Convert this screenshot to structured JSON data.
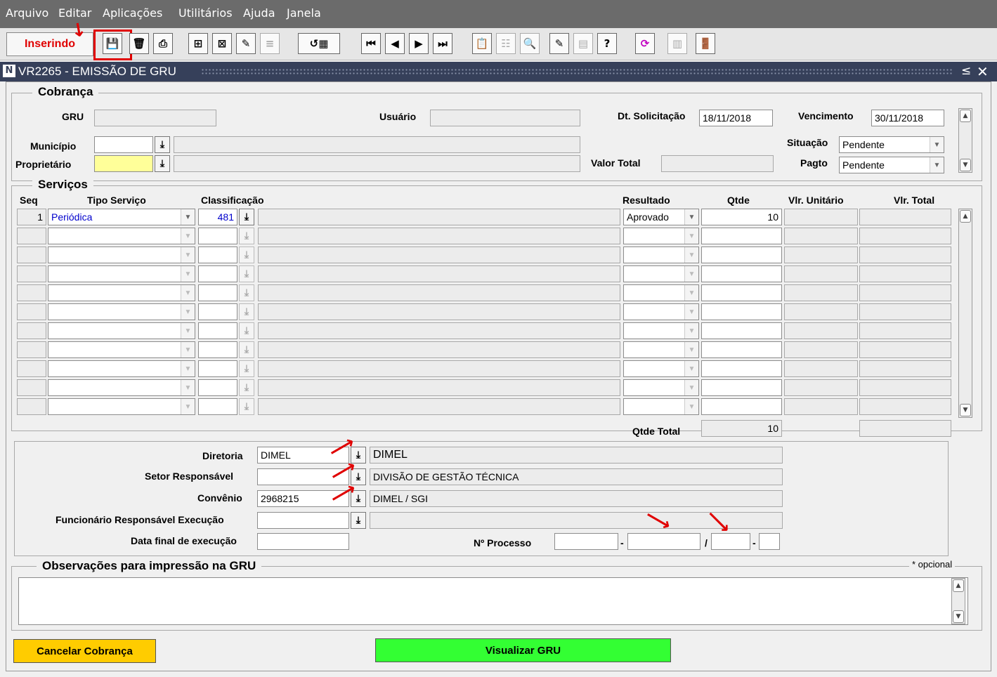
{
  "menu": [
    "Arquivo",
    "Editar",
    "Aplicações",
    "Utilitários",
    "Ajuda",
    "Janela"
  ],
  "toolbar": {
    "mode_label": "Inserindo"
  },
  "window": {
    "title": "VR2265 - EMISSÃO DE GRU"
  },
  "cobranca": {
    "title": "Cobrança",
    "gru_label": "GRU",
    "gru_value": "",
    "usuario_label": "Usuário",
    "usuario_value": "",
    "dt_solicitacao_label": "Dt. Solicitação",
    "dt_solicitacao_value": "18/11/2018",
    "vencimento_label": "Vencimento",
    "vencimento_value": "30/11/2018",
    "municipio_label": "Município",
    "municipio_value": "",
    "proprietario_label": "Proprietário",
    "proprietario_value": "",
    "situacao_label": "Situação",
    "situacao_value": "Pendente",
    "valor_total_label": "Valor Total",
    "valor_total_value": "",
    "pagto_label": "Pagto",
    "pagto_value": "Pendente"
  },
  "servicos": {
    "title": "Serviços",
    "columns": {
      "seq": "Seq",
      "tipo": "Tipo Serviço",
      "classificacao": "Classificação",
      "resultado": "Resultado",
      "qtde": "Qtde",
      "vlr_unitario": "Vlr. Unitário",
      "vlr_total": "Vlr. Total"
    },
    "rows": [
      {
        "seq": "1",
        "tipo": "Periódica",
        "classificacao": "481",
        "resultado": "Aprovado",
        "qtde": "10"
      },
      {
        "seq": "",
        "tipo": "",
        "classificacao": "",
        "resultado": "",
        "qtde": ""
      },
      {
        "seq": "",
        "tipo": "",
        "classificacao": "",
        "resultado": "",
        "qtde": ""
      },
      {
        "seq": "",
        "tipo": "",
        "classificacao": "",
        "resultado": "",
        "qtde": ""
      },
      {
        "seq": "",
        "tipo": "",
        "classificacao": "",
        "resultado": "",
        "qtde": ""
      },
      {
        "seq": "",
        "tipo": "",
        "classificacao": "",
        "resultado": "",
        "qtde": ""
      },
      {
        "seq": "",
        "tipo": "",
        "classificacao": "",
        "resultado": "",
        "qtde": ""
      },
      {
        "seq": "",
        "tipo": "",
        "classificacao": "",
        "resultado": "",
        "qtde": ""
      },
      {
        "seq": "",
        "tipo": "",
        "classificacao": "",
        "resultado": "",
        "qtde": ""
      },
      {
        "seq": "",
        "tipo": "",
        "classificacao": "",
        "resultado": "",
        "qtde": ""
      },
      {
        "seq": "",
        "tipo": "",
        "classificacao": "",
        "resultado": "",
        "qtde": ""
      }
    ],
    "qtde_total_label": "Qtde Total",
    "qtde_total_value": "10"
  },
  "responsavel": {
    "diretoria_label": "Diretoria",
    "diretoria_code": "DIMEL",
    "diretoria_desc": "DIMEL",
    "setor_label": "Setor Responsável",
    "setor_code": "",
    "setor_desc": "DIVISÃO DE GESTÃO TÉCNICA",
    "convenio_label": "Convênio",
    "convenio_code": "2968215",
    "convenio_desc": "DIMEL / SGI",
    "funcionario_label": "Funcionário Responsável Execução",
    "funcionario_code": "",
    "funcionario_desc": "",
    "data_final_label": "Data final de execução",
    "data_final_value": "",
    "processo_label": "Nº Processo",
    "processo_sep1": "-",
    "processo_sep2": "/",
    "processo_sep3": "-"
  },
  "observacoes": {
    "title": "Observações para impressão na GRU",
    "note": "* opcional",
    "text": ""
  },
  "buttons": {
    "cancelar": "Cancelar Cobrança",
    "visualizar": "Visualizar GRU"
  },
  "colors": {
    "cancel_button": "#ffcc00",
    "view_button": "#33ff33",
    "titlebar": "#36405a",
    "mode_text": "#e00000"
  }
}
